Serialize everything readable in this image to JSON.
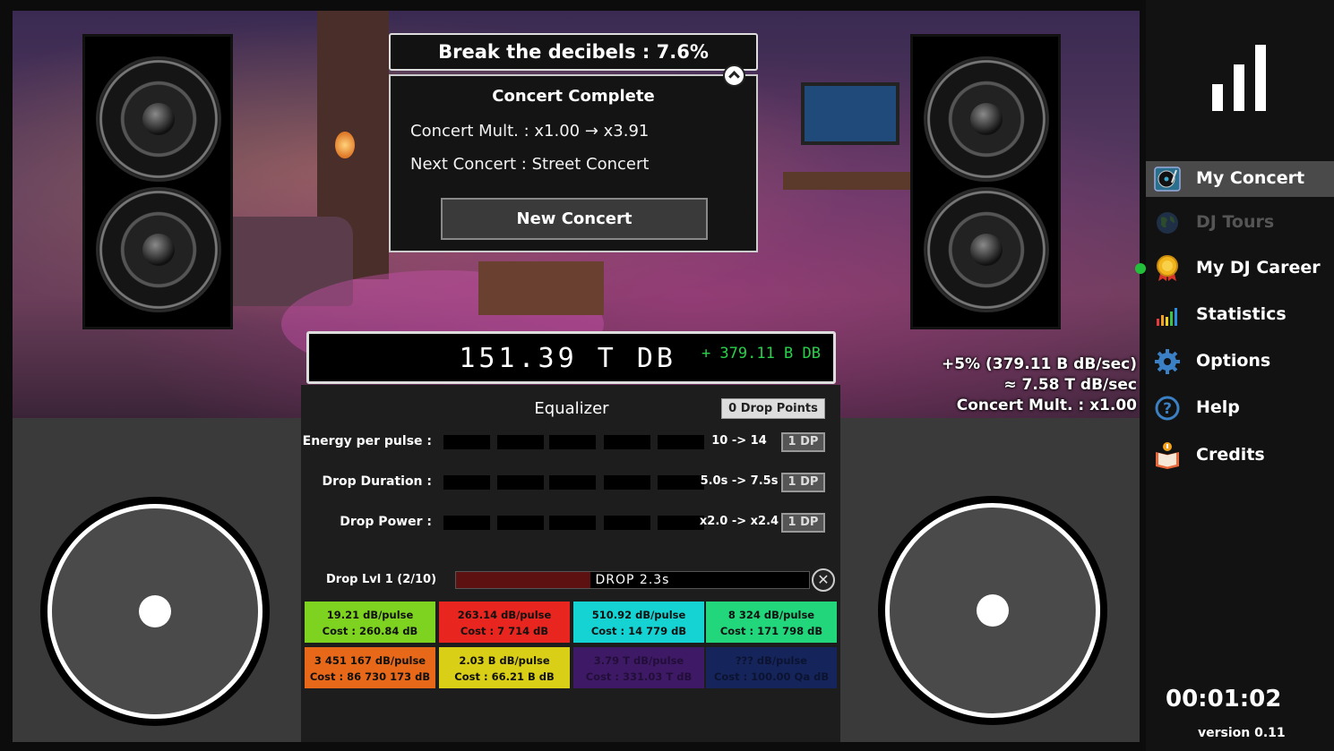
{
  "goal": {
    "text": "Break the decibels : 7.6%"
  },
  "concert": {
    "title": "Concert Complete",
    "mult_line": "Concert Mult. : x1.00 → x3.91",
    "next_line": "Next Concert : Street Concert",
    "button": "New Concert"
  },
  "counter": {
    "main": "151.39 T DB",
    "plus": "+ 379.11 B DB"
  },
  "rates": {
    "line1": "+5% (379.11 B dB/sec)",
    "line2": "≈ 7.58 T dB/sec",
    "line3": "Concert Mult. : x1.00"
  },
  "equalizer": {
    "title": "Equalizer",
    "drop_points": "0 Drop Points",
    "rows": [
      {
        "label": "Energy per pulse :",
        "range": "10 -> 14",
        "cost": "1 DP"
      },
      {
        "label": "Drop Duration :",
        "range": "5.0s -> 7.5s",
        "cost": "1 DP"
      },
      {
        "label": "Drop Power :",
        "range": "x2.0 -> x2.4",
        "cost": "1 DP"
      }
    ]
  },
  "drop": {
    "label": "Drop Lvl 1  (2/10)",
    "text": "DROP   2.3s",
    "progress": 0.38
  },
  "generators": [
    {
      "rate": "19.21  dB/pulse",
      "cost": "Cost : 260.84 dB",
      "color": "#7ed321",
      "locked": false
    },
    {
      "rate": "263.14  dB/pulse",
      "cost": "Cost : 7 714 dB",
      "color": "#e8261f",
      "locked": false
    },
    {
      "rate": "510.92  dB/pulse",
      "cost": "Cost : 14 779 dB",
      "color": "#16d3d3",
      "locked": false
    },
    {
      "rate": "8 324  dB/pulse",
      "cost": "Cost : 171 798 dB",
      "color": "#22d67c",
      "locked": false
    },
    {
      "rate": "3 451 167  dB/pulse",
      "cost": "Cost : 86 730 173 dB",
      "color": "#e8681a",
      "locked": false
    },
    {
      "rate": "2.03 B  dB/pulse",
      "cost": "Cost : 66.21 B dB",
      "color": "#d9cf16",
      "locked": false
    },
    {
      "rate": "3.79 T  dB/pulse",
      "cost": "Cost : 331.03 T dB",
      "color": "#3e1a66",
      "locked": true
    },
    {
      "rate": "???  dB/pulse",
      "cost": "Cost : 100.00 Qa dB",
      "color": "#15245a",
      "locked": true
    }
  ],
  "sidebar": {
    "items": [
      {
        "label": "My Concert",
        "icon": "turntable-icon",
        "active": true,
        "disabled": false
      },
      {
        "label": "DJ Tours",
        "icon": "globe-icon",
        "active": false,
        "disabled": true
      },
      {
        "label": "My DJ Career",
        "icon": "medal-icon",
        "active": false,
        "disabled": false,
        "notification": true
      },
      {
        "label": "Statistics",
        "icon": "bar-chart-icon",
        "active": false,
        "disabled": false
      },
      {
        "label": "Options",
        "icon": "gear-icon",
        "active": false,
        "disabled": false
      },
      {
        "label": "Help",
        "icon": "help-icon",
        "active": false,
        "disabled": false
      },
      {
        "label": "Credits",
        "icon": "book-icon",
        "active": false,
        "disabled": false
      }
    ]
  },
  "timer": "00:01:02",
  "version": "version 0.11"
}
